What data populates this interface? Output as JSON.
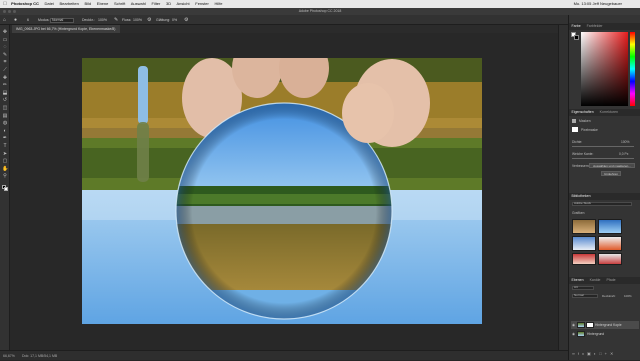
{
  "menubar": {
    "app": "Photoshop CC",
    "items": [
      "Datei",
      "Bearbeiten",
      "Bild",
      "Ebene",
      "Schrift",
      "Auswahl",
      "Filter",
      "3D",
      "Ansicht",
      "Fenster",
      "Hilfe"
    ],
    "status": "Mo. 13:05   Jeff Neugebauer"
  },
  "window": {
    "title": "Adobe Photoshop CC 2018"
  },
  "options_bar": {
    "mode_label": "Modus:",
    "mode_value": "Normal",
    "opacity_label": "Deckkr.:",
    "opacity_value": "100%",
    "flow_label": "Fluss:",
    "flow_value": "100%",
    "smoothing_label": "Glättung:",
    "smoothing_value": "0%"
  },
  "document_tab": {
    "label": "IMG_0963.JPG bei 66,7% (Hintergrund Kopie, Ebenenmaske/8)"
  },
  "status_bar": {
    "zoom": "66,67%",
    "doc": "Dok: 17,1 MB/54,1 MB"
  },
  "color_panel": {
    "tabs": [
      "Farbe",
      "Farbfelder"
    ]
  },
  "properties_panel": {
    "tabs": [
      "Eigenschaften",
      "Korrekturen"
    ],
    "section": "Masken",
    "mask_label": "Pixelmaske",
    "density_label": "Dichte:",
    "density_value": "100%",
    "feather_label": "Weiche Kante:",
    "feather_value": "0,0 Px",
    "refine_label": "Verbessern:",
    "select_mask_button": "Auswählen und maskieren...",
    "invert_button": "Umkehren"
  },
  "libraries_panel": {
    "tabs": [
      "Bibliotheken"
    ],
    "dropdown": "Adobe Stock",
    "section": "Grafiken"
  },
  "layers_panel": {
    "tabs": [
      "Ebenen",
      "Kanäle",
      "Pfade"
    ],
    "kind_label": "Art",
    "blend_mode": "Normal",
    "opacity_label": "Deckkraft:",
    "opacity_value": "100%",
    "layers": [
      {
        "name": "Hintergrund Kopie"
      },
      {
        "name": "Hintergrund"
      }
    ]
  },
  "icons": {
    "tools": [
      "move-icon",
      "marquee-icon",
      "lasso-icon",
      "quick-select-icon",
      "crop-icon",
      "eyedropper-icon",
      "healing-icon",
      "brush-icon",
      "stamp-icon",
      "history-brush-icon",
      "eraser-icon",
      "gradient-icon",
      "blur-icon",
      "dodge-icon",
      "pen-icon",
      "type-icon",
      "path-select-icon",
      "shape-icon",
      "hand-icon",
      "zoom-icon"
    ]
  },
  "colors": {
    "ui_dark": "#262626",
    "panel": "#343434",
    "accent": "#2d8ceb"
  }
}
